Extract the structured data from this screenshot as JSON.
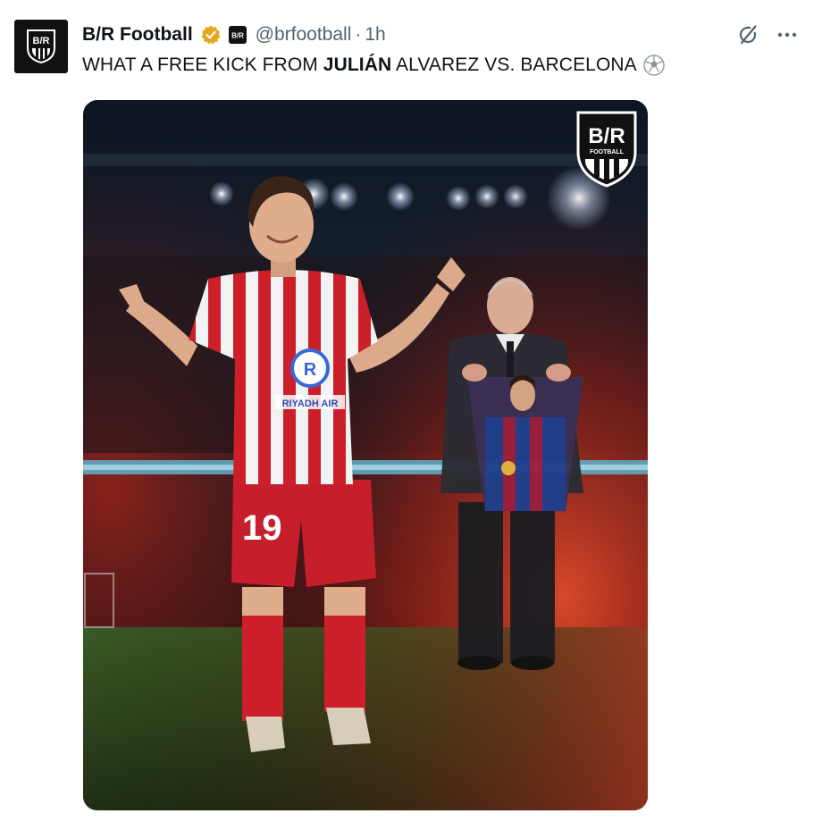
{
  "tweet": {
    "author_name": "B/R Football",
    "handle": "@brfootball",
    "separator": "·",
    "time": "1h",
    "text_part1": "WHAT A FREE KICK FROM ",
    "text_bold": "JULIÁN",
    "text_part2": " ALVAREZ VS. BARCELONA",
    "emoji_icon": "soccer-ball-emoji-icon",
    "avatar_logo_text": "B/R",
    "affiliate_badge_text": "B/R"
  },
  "media": {
    "logo_text": "B/R",
    "logo_subtext": "FOOTBALL",
    "jersey_sponsor": "RIYADH AIR",
    "shorts_number": "19"
  },
  "colors": {
    "verified_gold": "#e5a81c",
    "secondary_text": "#536471",
    "primary_text": "#0f1419"
  },
  "icons": {
    "grok": "grok-icon",
    "more": "more-dots-icon",
    "verified": "verified-badge-icon"
  }
}
